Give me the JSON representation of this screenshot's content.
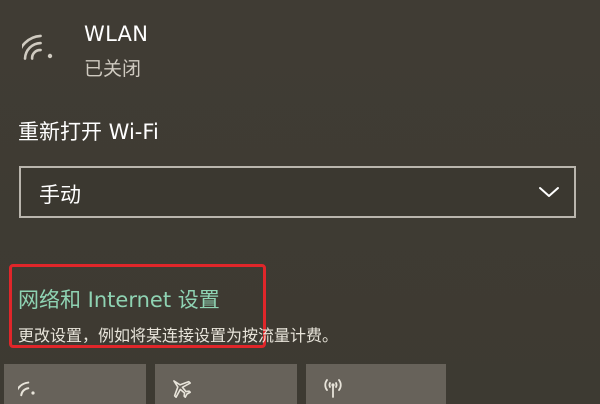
{
  "wlan": {
    "title": "WLAN",
    "status": "已关闭",
    "icon": "wifi-icon"
  },
  "reopen": {
    "label": "重新打开 Wi-Fi",
    "selected": "手动",
    "icon": "chevron-down-icon"
  },
  "network_settings": {
    "link_text": "网络和 Internet 设置",
    "description": "更改设置，例如将某连接设置为按流量计费。",
    "link_color": "#8fd3b3",
    "highlight_color": "#e0262a"
  },
  "quick_actions": [
    {
      "icon": "wifi-icon"
    },
    {
      "icon": "airplane-icon"
    },
    {
      "icon": "hotspot-icon"
    }
  ]
}
